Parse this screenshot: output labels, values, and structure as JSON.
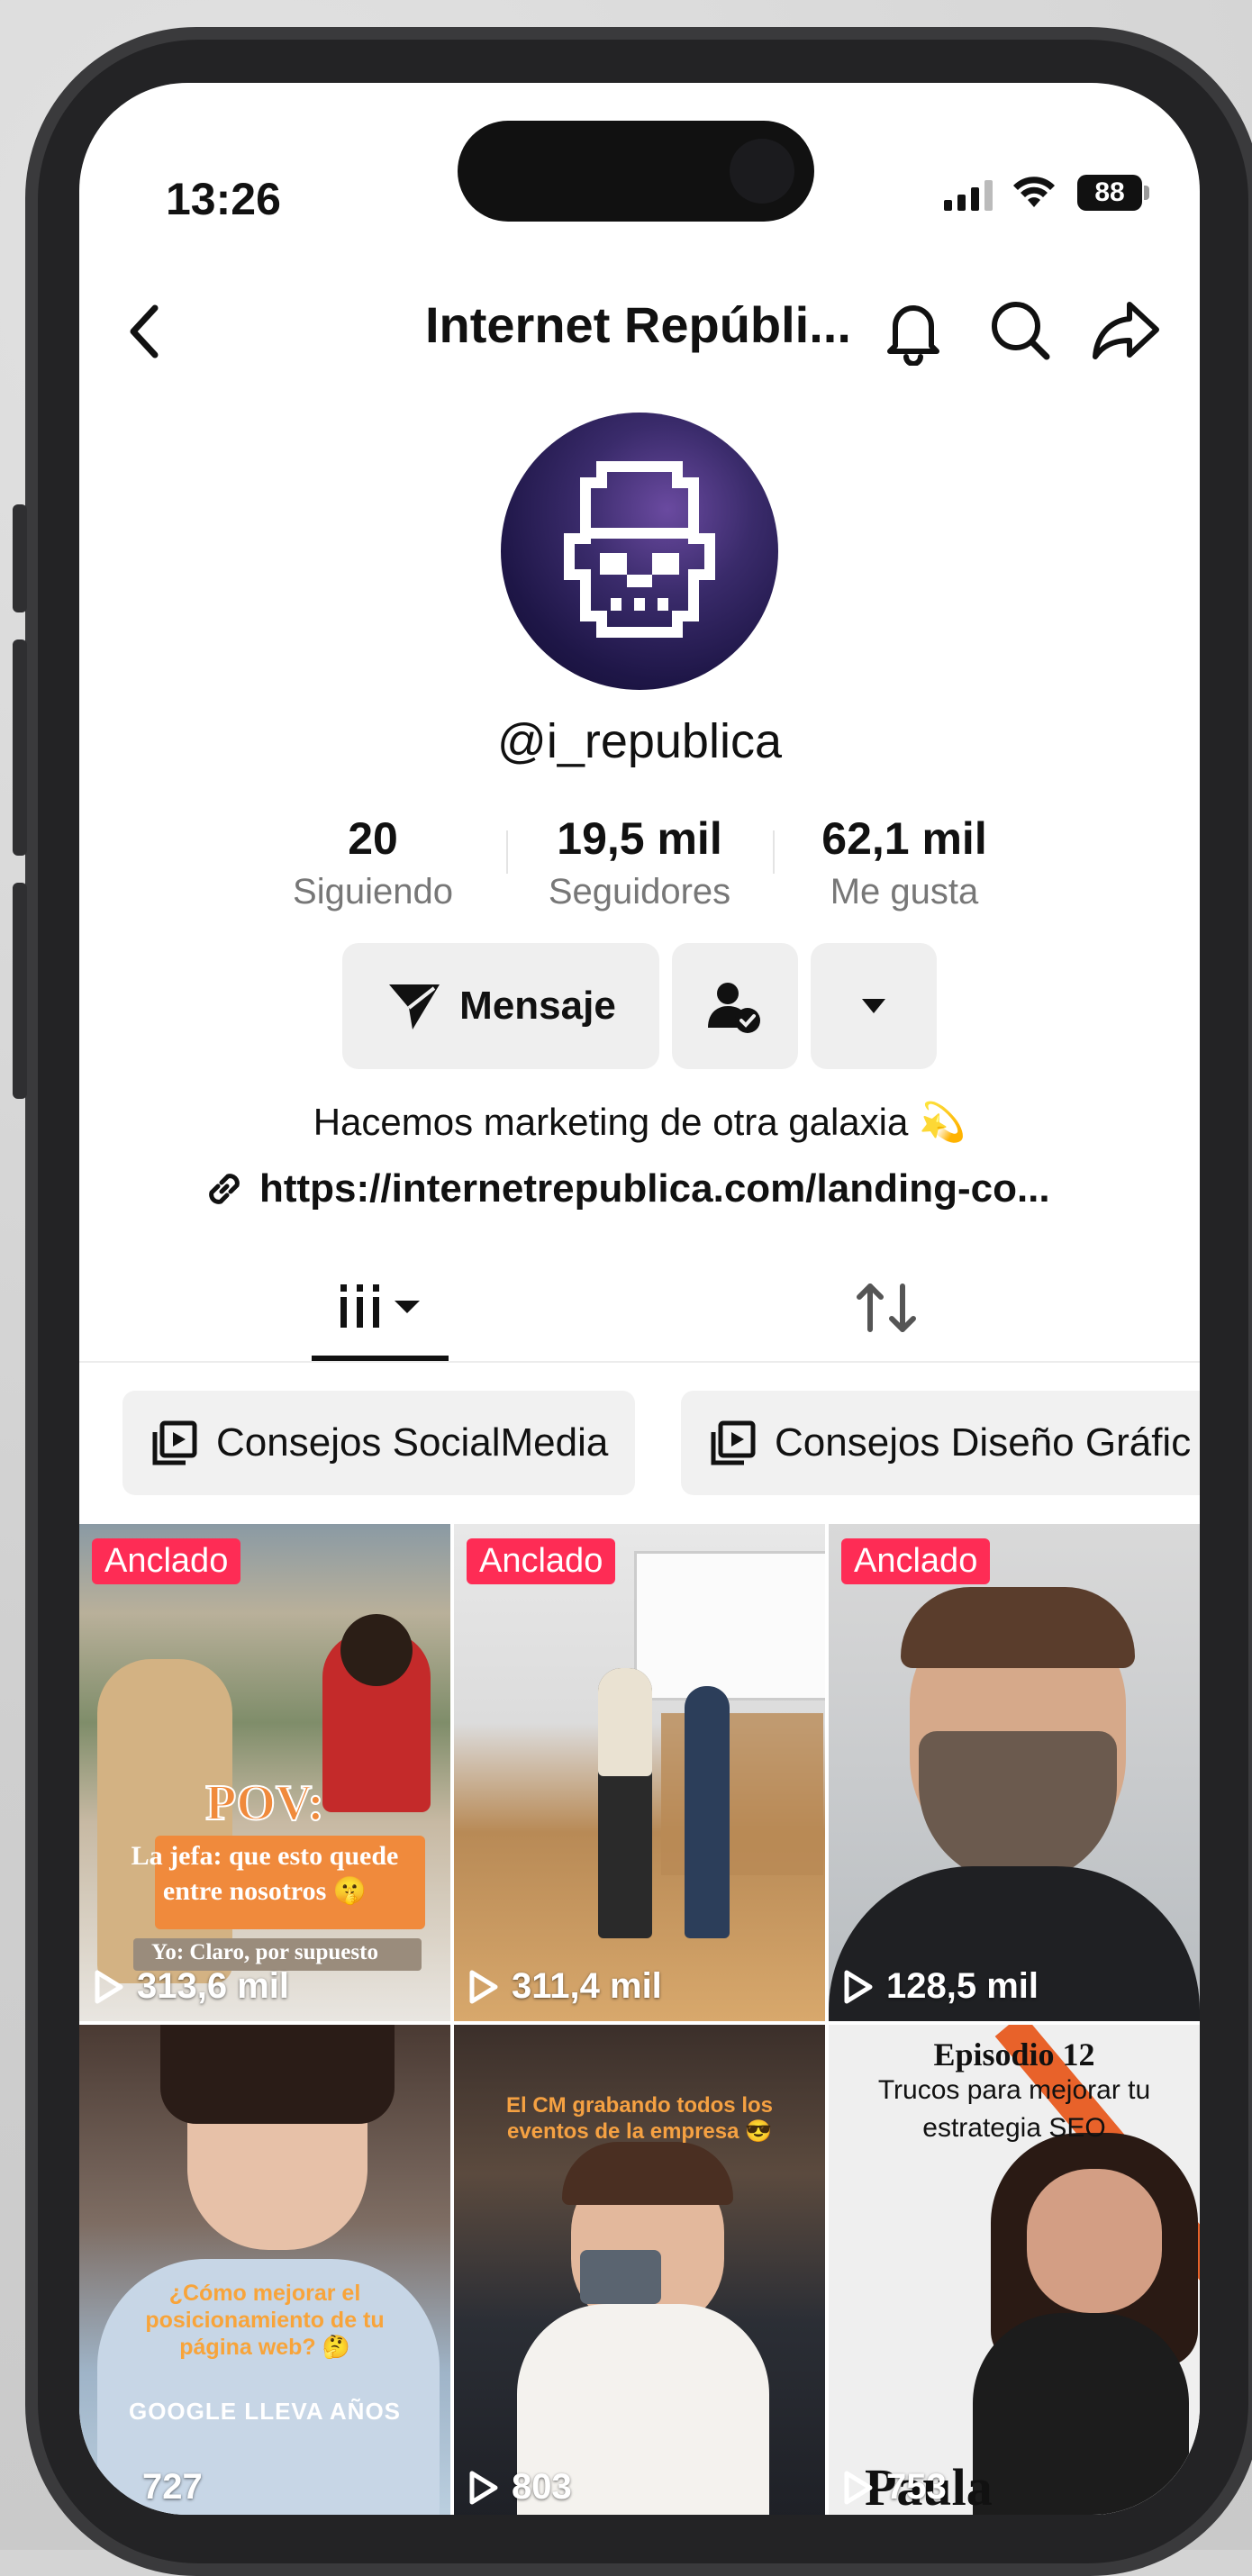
{
  "status_bar": {
    "time": "13:26",
    "battery": "88"
  },
  "header": {
    "title": "Internet Repúbli..."
  },
  "profile": {
    "handle": "@i_republica",
    "stats": [
      {
        "value": "20",
        "label": "Siguiendo"
      },
      {
        "value": "19,5 mil",
        "label": "Seguidores"
      },
      {
        "value": "62,1 mil",
        "label": "Me gusta"
      }
    ],
    "message_button": "Mensaje",
    "bio": "Hacemos marketing de otra galaxia 💫",
    "link": "https://internetrepublica.com/landing-co..."
  },
  "playlists": [
    "Consejos SocialMedia",
    "Consejos Diseño Gráfic"
  ],
  "videos": [
    {
      "pinned": "Anclado",
      "views": "313,6 mil",
      "overlay": [
        "POV:",
        "La jefa: que esto quede",
        "entre nosotros 🤫",
        "Yo: Claro, por supuesto"
      ]
    },
    {
      "pinned": "Anclado",
      "views": "311,4 mil",
      "overlay": []
    },
    {
      "pinned": "Anclado",
      "views": "128,5 mil",
      "overlay": []
    },
    {
      "pinned": "",
      "views": "727",
      "overlay": [
        "¿Cómo mejorar el",
        "posicionamiento de tu",
        "página web? 🤔",
        "GOOGLE LLEVA AÑOS"
      ]
    },
    {
      "pinned": "",
      "views": "803",
      "overlay": [
        "El CM grabando todos los",
        "eventos de la empresa 😎"
      ]
    },
    {
      "pinned": "",
      "views": "753",
      "overlay": [
        "Episodio 12",
        "Trucos para mejorar tu",
        "estrategia SEO",
        "Paula"
      ]
    }
  ],
  "colors": {
    "pinned_badge": "#fe2c55",
    "avatar_bg": "#2a1f5c"
  }
}
